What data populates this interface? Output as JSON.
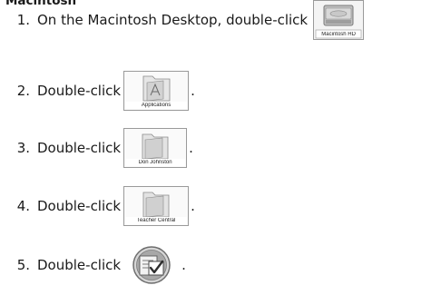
{
  "section": {
    "title": "Macintosh"
  },
  "steps": [
    {
      "number": "1.",
      "text": "On the Macintosh Desktop, double-click",
      "icon": "hard-drive-icon",
      "icon_label": "Macintosh HD",
      "suffix": ""
    },
    {
      "number": "2.",
      "text": "Double-click",
      "icon": "applications-folder-icon",
      "icon_label": "Applications",
      "suffix": "."
    },
    {
      "number": "3.",
      "text": "Double-click",
      "icon": "folder-icon",
      "icon_label": "Don Johnston",
      "suffix": "."
    },
    {
      "number": "4.",
      "text": "Double-click",
      "icon": "folder-icon",
      "icon_label": "Teacher Central",
      "suffix": "."
    },
    {
      "number": "5.",
      "text": "Double-click",
      "icon": "teacher-central-app-icon",
      "icon_label": "",
      "suffix": "."
    }
  ]
}
